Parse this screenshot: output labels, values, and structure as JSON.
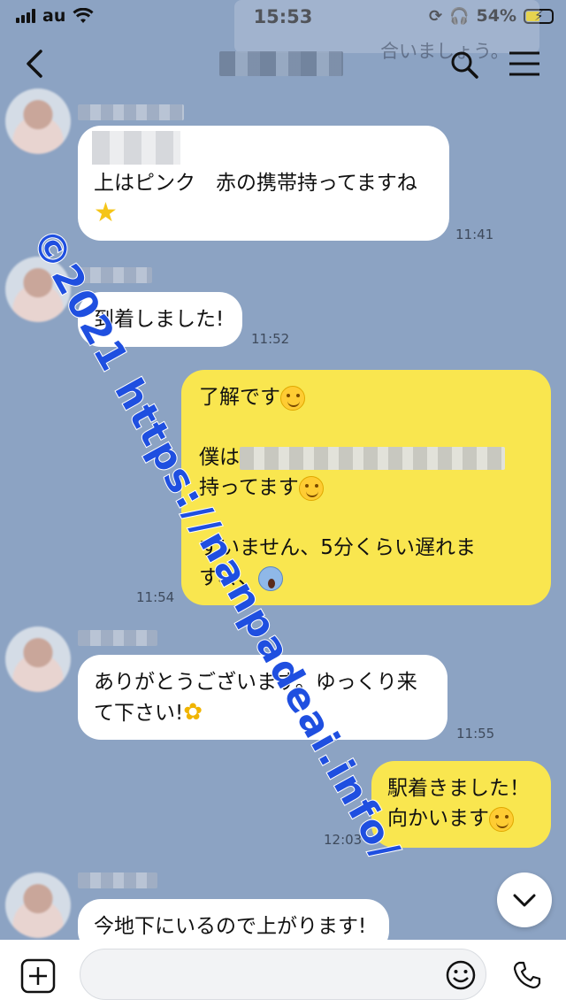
{
  "status_bar": {
    "carrier": "au",
    "time": "15:53",
    "battery": "54%"
  },
  "notification_preview": "合いましょう。",
  "messages": [
    {
      "id": "m1",
      "lines": [
        "上はピンク　赤の携帯持ってますね"
      ],
      "time": "11:41"
    },
    {
      "id": "m2",
      "lines": [
        "到着しました!"
      ],
      "time": "11:52"
    },
    {
      "id": "m3",
      "lines": [
        "了解です",
        "僕は",
        "持ってます",
        "すいません、5分くらい遅れま",
        "す、、、"
      ],
      "time": "11:54"
    },
    {
      "id": "m4",
      "lines": [
        "ありがとうございます。ゆっくり来",
        "て下さい!"
      ],
      "time": "11:55"
    },
    {
      "id": "m5",
      "lines": [
        "駅着きました！",
        "向かいます"
      ],
      "time": "12:03"
    },
    {
      "id": "m6",
      "lines": [
        "今地下にいるので上がります!"
      ],
      "time": ""
    }
  ],
  "watermark": "©2021 https://nanpadeai.info/",
  "composer": {
    "placeholder": "",
    "value": ""
  },
  "icons": {
    "back": "chevron-left-icon",
    "search": "search-icon",
    "menu": "hamburger-menu-icon",
    "scroll": "chevron-down-icon",
    "plus": "plus-square-icon",
    "emoji": "smiley-icon",
    "phone": "phone-icon"
  }
}
